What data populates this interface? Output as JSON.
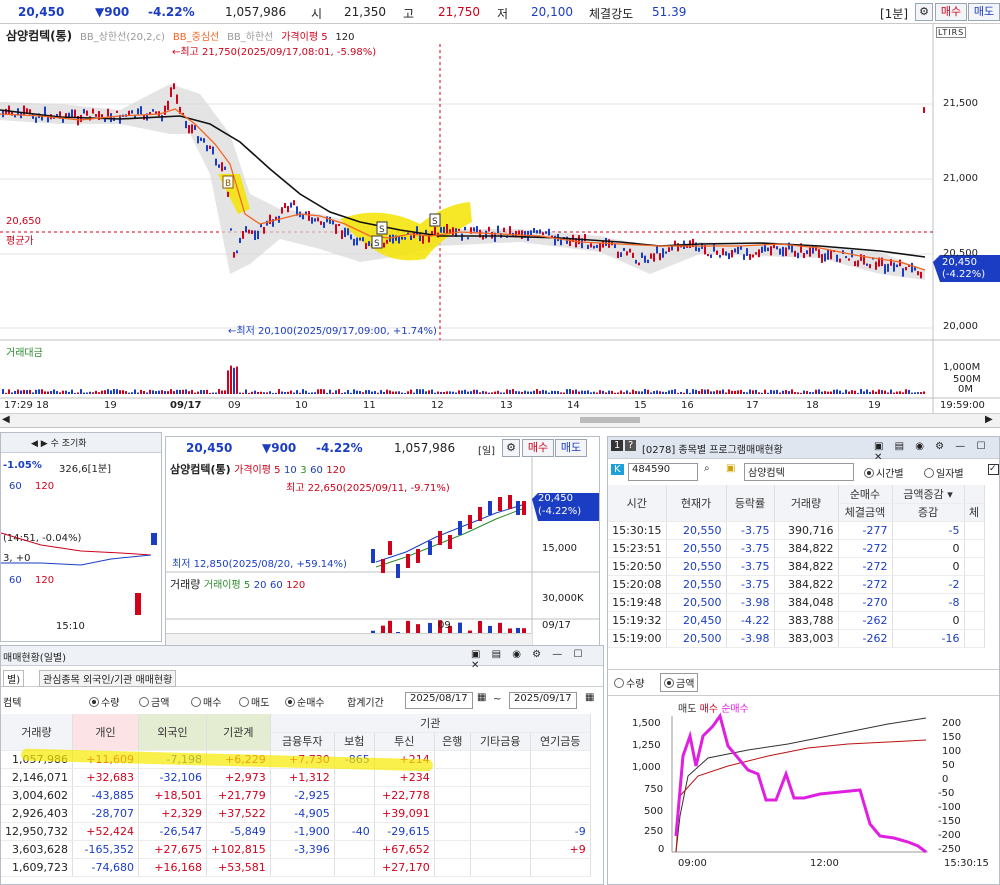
{
  "top": {
    "price": "20,450",
    "change": "▼900",
    "pct": "-4.22%",
    "volume": "1,057,986",
    "open_label": "시",
    "open": "21,350",
    "high_label": "고",
    "high": "21,750",
    "low_label": "저",
    "low": "20,100",
    "strength_label": "체결강도",
    "strength": "51.39",
    "interval": "[1분]",
    "sell": "매수",
    "buy": "매도"
  },
  "main_chart": {
    "stock": "삼양컴텍(통)",
    "ind1": "BB_상한선(20,2,c)",
    "ind2": "BB_중심선",
    "ind3": "BB_하한선",
    "ind4": "가격이평 5",
    "ind5": "120",
    "high_note": "←최고 21,750(2025/09/17,08:01, -5.98%)",
    "low_note": "←최저 20,100(2025/09/17,09:00, +1.74%)",
    "avg_price": "20,650",
    "avg_label": "평균가",
    "y_ticks": [
      "21,500",
      "21,000",
      "20,500",
      "20,000"
    ],
    "cur_price": "20,450",
    "cur_pct": "(-4.22%)",
    "vol_label": "거래대금",
    "vol_ticks": [
      "1,000M",
      "500M",
      "0M"
    ],
    "x_ticks": [
      "17:29 18",
      "19",
      "09/17",
      "09",
      "10",
      "11",
      "12",
      "13",
      "14",
      "15",
      "16",
      "17",
      "18",
      "19",
      "19:59:00"
    ],
    "lti": "LTIRS"
  },
  "left_mid": {
    "pct": "-1.05%",
    "vol": "326,6[1분]",
    "btn1": "조기화",
    "ma1": "60",
    "ma2": "120",
    "ma3": "60",
    "ma4": "120",
    "note1": "(14:51, -0.04%)",
    "note2": "3, +0",
    "time": "15:10"
  },
  "daily": {
    "price": "20,450",
    "change": "▼900",
    "pct": "-4.22%",
    "volume": "1,057,986",
    "interval": "[일]",
    "buy": "매수",
    "sell": "매도",
    "stock": "삼양컴텍(통)",
    "ind": "가격이평 5",
    "ma": [
      "10",
      "3",
      "60",
      "120"
    ],
    "high_note": "최고 22,650(2025/09/11, -9.71%)",
    "low_note": "최저 12,850(2025/08/20, +59.14%)",
    "y_tick": "15,000",
    "cur": "20,450",
    "cur_pct": "(-4.22%)",
    "vol_label": "거래량",
    "vol_ind": "거래이평 5",
    "vol_ma": [
      "20",
      "60",
      "120"
    ],
    "vol_tick": "30,000K",
    "x1": "09",
    "x2": "09/17"
  },
  "investor": {
    "title": "매매현황(일별)",
    "tab1": "별)",
    "tab2": "관심종목 외국인/기관 매매현황",
    "stock": "컴텍",
    "opt1": "수량",
    "opt2": "금액",
    "opt3": "매수",
    "opt4": "매도",
    "opt5": "순매수",
    "period_label": "합계기간",
    "from": "2025/08/17",
    "to": "2025/09/17",
    "institution": "기관",
    "headers": [
      "거래량",
      "개인",
      "외국인",
      "기관계",
      "금융투자",
      "보험",
      "투신",
      "은행",
      "기타금융",
      "연기금등"
    ],
    "rows": [
      [
        "1,057,986",
        "+11,609",
        "-7,198",
        "+6,229",
        "+7,730",
        "-865",
        "+214",
        "",
        "",
        ""
      ],
      [
        "2,146,071",
        "+32,683",
        "-32,106",
        "+2,973",
        "+1,312",
        "",
        "+234",
        "",
        "",
        ""
      ],
      [
        "3,004,602",
        "-43,885",
        "+18,501",
        "+21,779",
        "-2,925",
        "",
        "+22,778",
        "",
        "",
        ""
      ],
      [
        "2,926,403",
        "-28,707",
        "+2,329",
        "+37,522",
        "-4,905",
        "",
        "+39,091",
        "",
        "",
        ""
      ],
      [
        "12,950,732",
        "+52,424",
        "-26,547",
        "-5,849",
        "-1,900",
        "-40",
        "-29,615",
        "",
        "",
        "-9"
      ],
      [
        "3,603,628",
        "-165,352",
        "+27,675",
        "+102,815",
        "-3,396",
        "",
        "+67,652",
        "",
        "",
        "+9"
      ],
      [
        "1,609,723",
        "-74,680",
        "+16,168",
        "+53,581",
        "",
        "",
        "+27,170",
        "",
        "",
        ""
      ]
    ]
  },
  "program": {
    "title": "[0278] 종목별 프로그램매매현황",
    "code": "484590",
    "stock": "삼양컴텍",
    "opt1": "시간별",
    "opt2": "일자별",
    "headers": [
      "시간",
      "현재가",
      "등락률",
      "거래량"
    ],
    "net_label": "순매수",
    "amount_sel": "금액증감",
    "sub1": "체결금액",
    "sub2": "증감",
    "sub3": "체",
    "rows": [
      [
        "15:30:15",
        "20,550",
        "-3.75",
        "390,716",
        "-277",
        "-5"
      ],
      [
        "15:23:51",
        "20,550",
        "-3.75",
        "384,822",
        "-272",
        "0"
      ],
      [
        "15:20:50",
        "20,550",
        "-3.75",
        "384,822",
        "-272",
        "0"
      ],
      [
        "15:20:08",
        "20,550",
        "-3.75",
        "384,822",
        "-272",
        "-2"
      ],
      [
        "15:19:48",
        "20,500",
        "-3.98",
        "384,048",
        "-270",
        "-8"
      ],
      [
        "15:19:32",
        "20,450",
        "-4.22",
        "383,788",
        "-262",
        "0"
      ],
      [
        "15:19:00",
        "20,500",
        "-3.98",
        "383,003",
        "-262",
        "-16"
      ]
    ],
    "r1": "수량",
    "r2": "금액",
    "leg1": "매도",
    "leg2": "매수",
    "leg3": "순매수",
    "left_ticks": [
      "1,500",
      "1,250",
      "1,000",
      "750",
      "500",
      "250",
      "0"
    ],
    "right_ticks": [
      "200",
      "150",
      "100",
      "50",
      "0",
      "-50",
      "-100",
      "-150",
      "-200",
      "-250"
    ],
    "x1": "09:00",
    "x2": "12:00",
    "x3": "15:30:15"
  }
}
